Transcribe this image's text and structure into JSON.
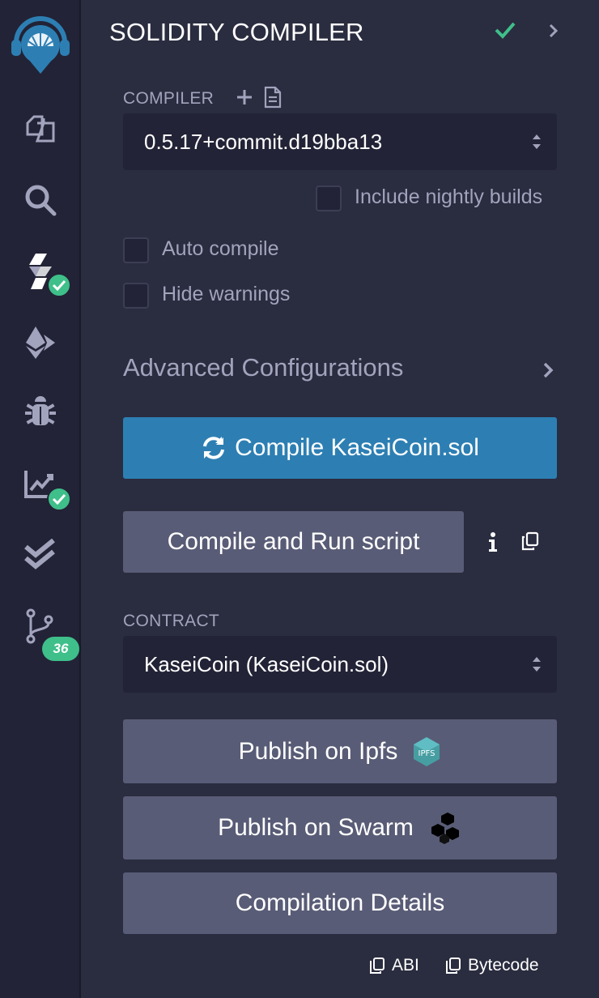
{
  "header": {
    "title": "SOLIDITY COMPILER"
  },
  "compiler": {
    "label": "COMPILER",
    "version": "0.5.17+commit.d19bba13",
    "include_nightly_label": "Include nightly builds"
  },
  "options": {
    "auto_compile_label": "Auto compile",
    "hide_warnings_label": "Hide warnings"
  },
  "advanced": {
    "label": "Advanced Configurations"
  },
  "buttons": {
    "compile_label": "Compile KaseiCoin.sol",
    "compile_run_label": "Compile and Run script",
    "publish_ipfs_label": "Publish on Ipfs",
    "publish_swarm_label": "Publish on Swarm",
    "details_label": "Compilation Details"
  },
  "contract": {
    "label": "CONTRACT",
    "selected": "KaseiCoin (KaseiCoin.sol)"
  },
  "footer": {
    "abi_label": "ABI",
    "bytecode_label": "Bytecode"
  },
  "rail": {
    "git_badge_count": "36"
  },
  "icons": {
    "ipfs_text": "IPFS",
    "rail": [
      "remix-logo-icon",
      "file-explorer-icon",
      "search-icon",
      "solidity-compiler-icon",
      "deploy-ethereum-icon",
      "debugger-icon",
      "analysis-icon",
      "unit-testing-icon",
      "git-branch-icon"
    ]
  },
  "colors": {
    "accent": "#2d7fb3",
    "success": "#3fbf8a",
    "panel_bg": "#2a2c3f",
    "rail_bg": "#222336",
    "button_secondary": "#595c76"
  }
}
